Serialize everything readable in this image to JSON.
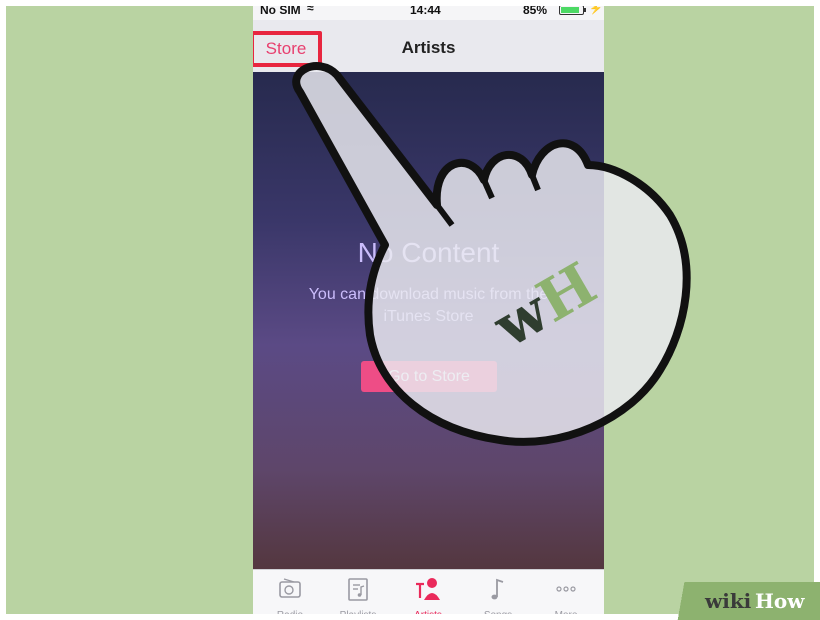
{
  "status": {
    "carrier": "No SIM",
    "time": "14:44",
    "battery": "85%"
  },
  "navbar": {
    "store_label": "Store",
    "title": "Artists"
  },
  "empty_state": {
    "heading": "No Content",
    "message": "You can download music from the iTunes Store",
    "button": "Go to Store"
  },
  "tabs": [
    {
      "label": "Radio",
      "icon": "radio-icon"
    },
    {
      "label": "Playlists",
      "icon": "playlist-icon"
    },
    {
      "label": "Artists",
      "icon": "artists-icon",
      "active": true
    },
    {
      "label": "Songs",
      "icon": "music-note-icon"
    },
    {
      "label": "More",
      "icon": "more-icon"
    }
  ],
  "overlay": {
    "badge": "wH",
    "logo_wiki": "wiki",
    "logo_how": "How"
  },
  "colors": {
    "accent": "#ea2a5b",
    "highlight": "#e8263f",
    "background": "#b9d3a2"
  }
}
